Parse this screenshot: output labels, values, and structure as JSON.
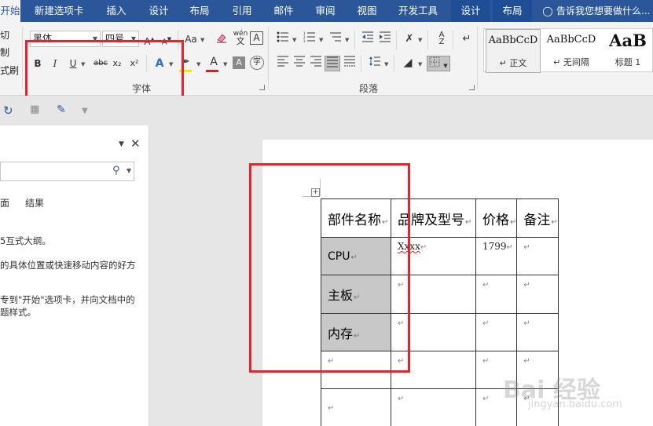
{
  "tabs": [
    {
      "label": "开始",
      "active": true
    },
    {
      "label": "新建选项卡"
    },
    {
      "label": "插入"
    },
    {
      "label": "设计"
    },
    {
      "label": "布局"
    },
    {
      "label": "引用"
    },
    {
      "label": "邮件"
    },
    {
      "label": "审阅"
    },
    {
      "label": "视图"
    },
    {
      "label": "开发工具"
    },
    {
      "label": "设计",
      "contextual": true
    },
    {
      "label": "布局",
      "contextual": true
    }
  ],
  "tell_me": {
    "placeholder": "告诉我您想要做什么..."
  },
  "clipboard": {
    "cut": "切",
    "copy": "制",
    "format_painter": "式刷"
  },
  "font_group": {
    "label": "字体",
    "font_name": "黑体",
    "font_size": "四号",
    "grow_icon": "A^",
    "shrink_icon": "Aˇ",
    "change_case": "Aa",
    "clear_format": "clear-format-icon",
    "phonetic": "wén",
    "char_border": "A",
    "bold": "B",
    "italic": "I",
    "underline": "U",
    "strikethrough": "abc",
    "subscript": "x₂",
    "superscript": "x²",
    "text_effect": "A",
    "highlight_color": "#f5e800",
    "font_color_letter": "A",
    "font_color": "#e01c1c",
    "char_shading": "A",
    "enclose_char": "字"
  },
  "paragraph_group": {
    "label": "段落"
  },
  "styles": [
    {
      "sample": "AaBbCcD",
      "name": "↵ 正文",
      "selected": true
    },
    {
      "sample": "AaBbCcD",
      "name": "↵ 无间隔"
    },
    {
      "sample": "AaB",
      "name": "标题 1"
    }
  ],
  "nav_pane": {
    "tabs": [
      "面",
      "结果"
    ],
    "lines": [
      "5互式大纲。",
      "的具体位置或快速移动内容的好方",
      "",
      "专到\"开始\"选项卡，并向文档中的",
      "题样式。"
    ]
  },
  "table": {
    "headers": [
      "部件名称",
      "品牌及型号",
      "价格",
      "备注"
    ],
    "rows": [
      [
        "CPU",
        "Xxxx",
        "1799",
        ""
      ],
      [
        "主板",
        "",
        "",
        ""
      ],
      [
        "内存",
        "",
        "",
        ""
      ],
      [
        "",
        "",
        "",
        ""
      ],
      [
        "",
        "",
        "",
        ""
      ]
    ]
  },
  "watermark": {
    "text": "Bai 经验",
    "sub": "jingyan.baidu.com"
  }
}
